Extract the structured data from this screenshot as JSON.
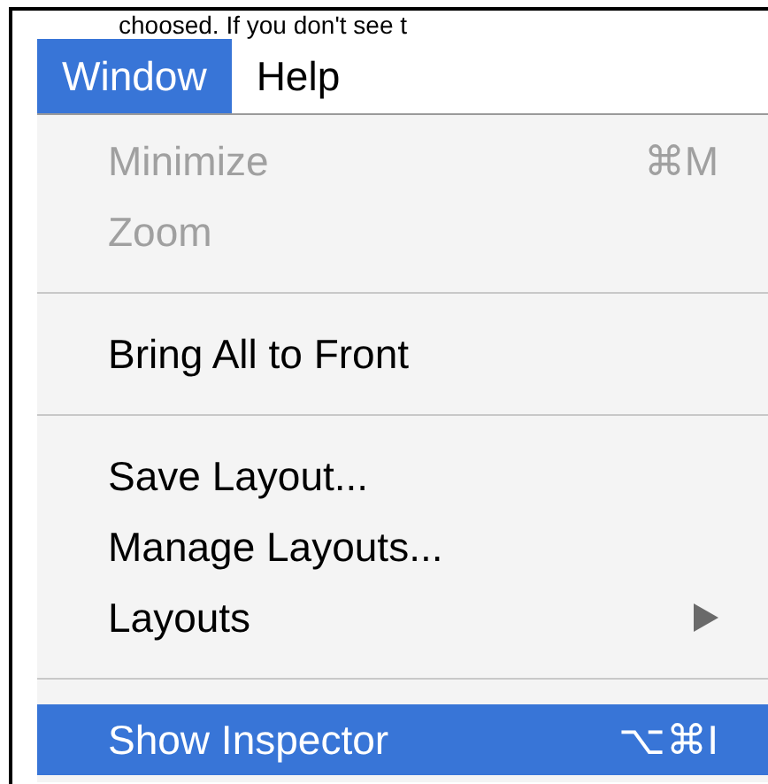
{
  "caption": "choosed.  If you don't see t",
  "menu_bar": [
    {
      "label": "Window",
      "selected": true
    },
    {
      "label": "Help",
      "selected": false
    }
  ],
  "menu_items": [
    {
      "kind": "item",
      "label": "Minimize",
      "shortcut": "⌘M",
      "disabled": true,
      "selected": false,
      "submenu": false
    },
    {
      "kind": "item",
      "label": "Zoom",
      "disabled": true,
      "selected": false,
      "submenu": false
    },
    {
      "kind": "separator"
    },
    {
      "kind": "item",
      "label": "Bring All to Front",
      "disabled": false,
      "selected": false,
      "submenu": false
    },
    {
      "kind": "separator"
    },
    {
      "kind": "item",
      "label": "Save Layout...",
      "disabled": false,
      "selected": false,
      "submenu": false
    },
    {
      "kind": "item",
      "label": "Manage Layouts...",
      "disabled": false,
      "selected": false,
      "submenu": false
    },
    {
      "kind": "item",
      "label": "Layouts",
      "disabled": false,
      "selected": false,
      "submenu": true
    },
    {
      "kind": "separator"
    },
    {
      "kind": "item",
      "label": "Show Inspector",
      "shortcut": "⌥⌘I",
      "disabled": false,
      "selected": true,
      "submenu": false
    }
  ]
}
